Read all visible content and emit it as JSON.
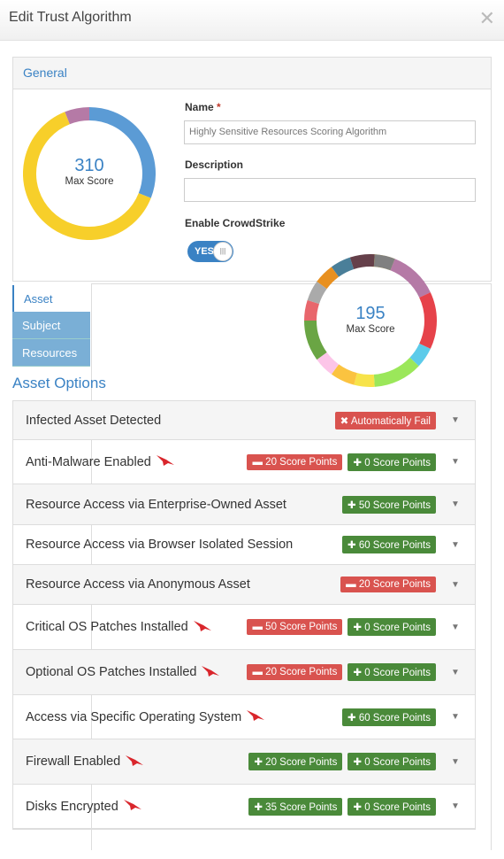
{
  "dialog": {
    "title": "Edit Trust Algorithm",
    "close_icon": "close-icon"
  },
  "general": {
    "heading": "General",
    "name_label": "Name",
    "required_mark": "*",
    "name_value": "Highly Sensitive Resources Scoring Algorithm",
    "description_label": "Description",
    "description_value": "",
    "crowdstrike_label": "Enable CrowdStrike",
    "toggle_label": "YES",
    "toggle_on": true
  },
  "donut_main": {
    "value": "310",
    "label": "Max Score",
    "segments": [
      {
        "fraction": 0.31,
        "color": "#5b9bd5"
      },
      {
        "fraction": 0.63,
        "color": "#f7cf2a"
      },
      {
        "fraction": 0.06,
        "color": "#b57aa6"
      }
    ]
  },
  "donut_asset": {
    "value": "195",
    "label": "Max Score",
    "segments": [
      {
        "fraction": 0.06,
        "color": "#f7cf2a"
      },
      {
        "fraction": 0.12,
        "color": "#b57aa6"
      },
      {
        "fraction": 0.14,
        "color": "#e6424a"
      },
      {
        "fraction": 0.05,
        "color": "#5ccbea"
      },
      {
        "fraction": 0.12,
        "color": "#9be75a"
      },
      {
        "fraction": 0.05,
        "color": "#f7e34a"
      },
      {
        "fraction": 0.06,
        "color": "#fbc340"
      },
      {
        "fraction": 0.05,
        "color": "#fcc5e8"
      },
      {
        "fraction": 0.1,
        "color": "#6aa544"
      },
      {
        "fraction": 0.05,
        "color": "#e8666c"
      },
      {
        "fraction": 0.05,
        "color": "#aaaaaa"
      },
      {
        "fraction": 0.05,
        "color": "#e89020"
      },
      {
        "fraction": 0.05,
        "color": "#4a7f99"
      },
      {
        "fraction": 0.06,
        "color": "#65404a"
      },
      {
        "fraction": 0.05,
        "color": "#808080"
      }
    ]
  },
  "tabs": [
    {
      "label": "Asset",
      "active": true
    },
    {
      "label": "Subject",
      "active": false
    },
    {
      "label": "Resources",
      "active": false
    }
  ],
  "asset_options": {
    "heading": "Asset Options",
    "rows": [
      {
        "name": "Infected Asset Detected",
        "crowdstrike": false,
        "badges": [
          {
            "type": "fail",
            "text": "Automatically Fail"
          }
        ]
      },
      {
        "name": "Anti-Malware Enabled",
        "crowdstrike": true,
        "badges": [
          {
            "type": "minus",
            "text": "20 Score Points"
          },
          {
            "type": "plus",
            "text": "0 Score Points"
          }
        ]
      },
      {
        "name": "Resource Access via Enterprise-Owned Asset",
        "crowdstrike": false,
        "badges": [
          {
            "type": "plus",
            "text": "50 Score Points"
          }
        ]
      },
      {
        "name": "Resource Access via Browser Isolated Session",
        "crowdstrike": false,
        "badges": [
          {
            "type": "plus",
            "text": "60 Score Points"
          }
        ]
      },
      {
        "name": "Resource Access via Anonymous Asset",
        "crowdstrike": false,
        "badges": [
          {
            "type": "minus",
            "text": "20 Score Points"
          }
        ]
      },
      {
        "name": "Critical OS Patches Installed",
        "crowdstrike": true,
        "badges": [
          {
            "type": "minus",
            "text": "50 Score Points"
          },
          {
            "type": "plus",
            "text": "0 Score Points"
          }
        ]
      },
      {
        "name": "Optional OS Patches Installed",
        "crowdstrike": true,
        "badges": [
          {
            "type": "minus",
            "text": "20 Score Points"
          },
          {
            "type": "plus",
            "text": "0 Score Points"
          }
        ]
      },
      {
        "name": "Access via Specific Operating System",
        "crowdstrike": true,
        "badges": [
          {
            "type": "plus",
            "text": "60 Score Points"
          }
        ]
      },
      {
        "name": "Firewall Enabled",
        "crowdstrike": true,
        "badges": [
          {
            "type": "plus",
            "text": "20 Score Points"
          },
          {
            "type": "plus",
            "text": "0 Score Points"
          }
        ]
      },
      {
        "name": "Disks Encrypted",
        "crowdstrike": true,
        "badges": [
          {
            "type": "plus",
            "text": "35 Score Points"
          },
          {
            "type": "plus",
            "text": "0 Score Points"
          }
        ]
      }
    ]
  }
}
